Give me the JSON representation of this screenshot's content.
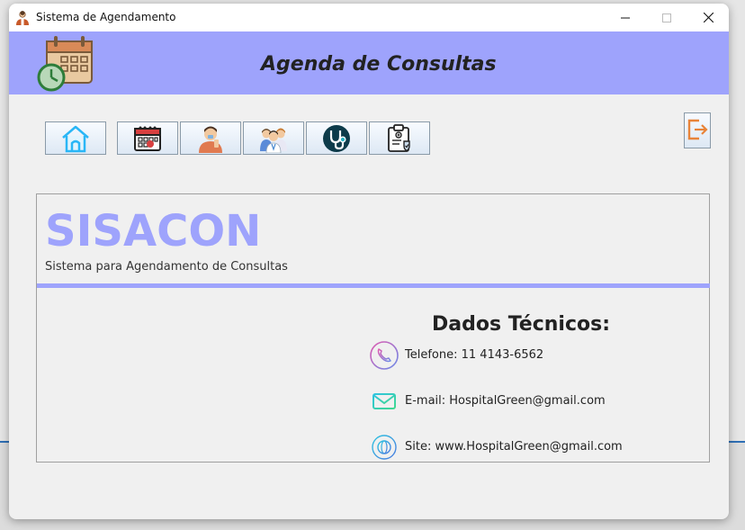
{
  "window": {
    "title": "Sistema de Agendamento",
    "controls": [
      "minimize",
      "maximize",
      "close"
    ]
  },
  "banner": {
    "title": "Agenda de Consultas",
    "background": "#9ea3fc",
    "logo_icon": "calendar-clock-icon"
  },
  "toolbar": {
    "buttons": [
      {
        "name": "home",
        "icon": "home-icon"
      },
      {
        "name": "agenda",
        "icon": "calendar-icon"
      },
      {
        "name": "pacientes",
        "icon": "patient-icon"
      },
      {
        "name": "equipe",
        "icon": "team-icon"
      },
      {
        "name": "medicos",
        "icon": "stethoscope-icon"
      },
      {
        "name": "planos",
        "icon": "clipboard-icon"
      }
    ],
    "logout_icon": "logout-icon"
  },
  "main": {
    "brand": "SISACON",
    "subtitle": "Sistema para Agendamento de Consultas",
    "accent": "#9ea3fc",
    "tech_title": "Dados Técnicos:",
    "contacts": [
      {
        "icon": "phone-icon",
        "text": "Telefone: 11 4143-6562"
      },
      {
        "icon": "mail-icon",
        "text": "E-mail: HospitalGreen@gmail.com"
      },
      {
        "icon": "globe-icon",
        "text": "Site: www.HospitalGreen@gmail.com"
      }
    ]
  }
}
